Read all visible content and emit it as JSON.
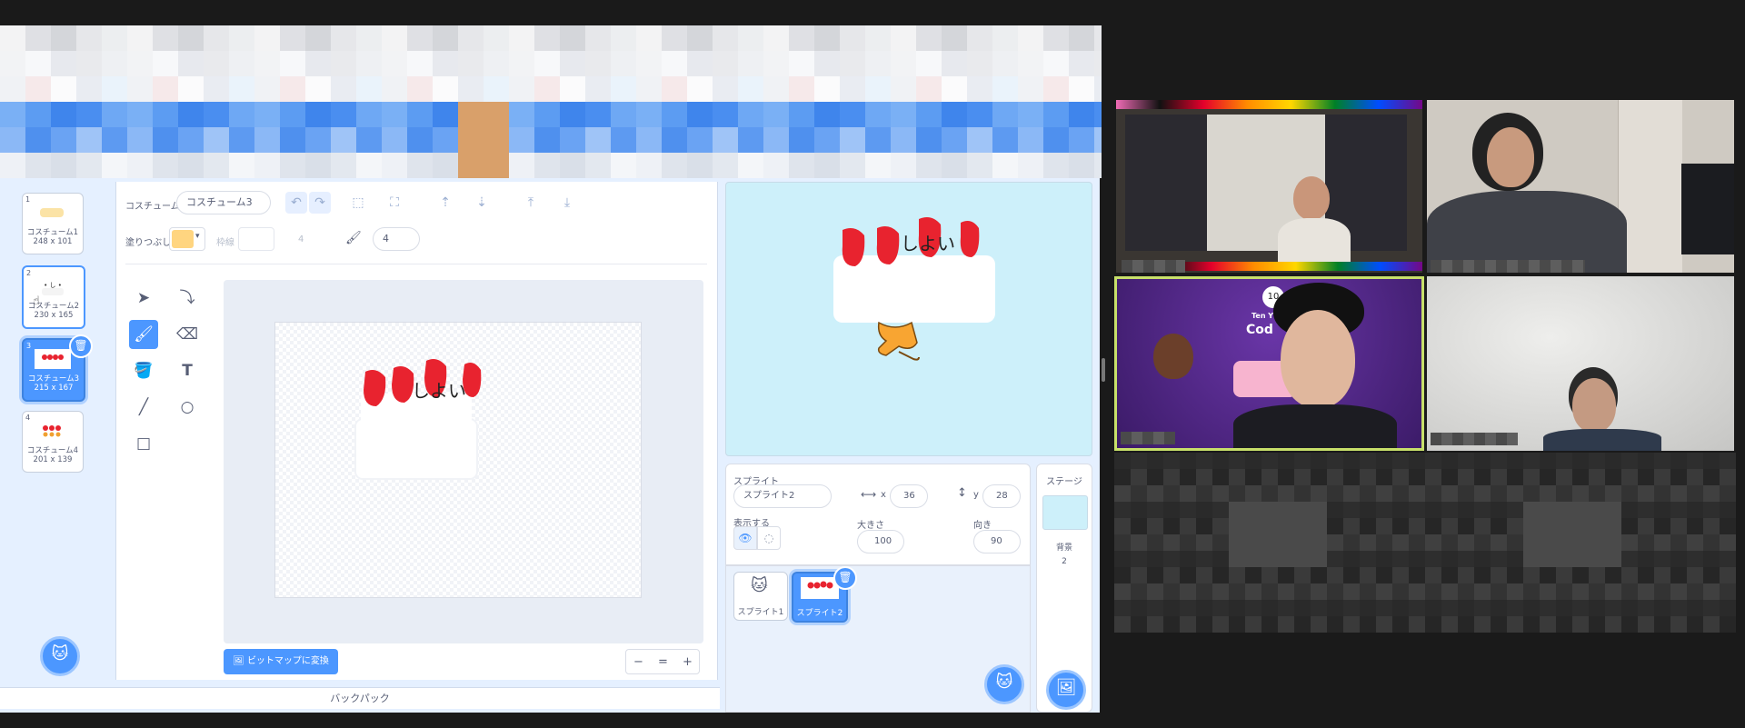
{
  "editor": {
    "costumes": [
      {
        "num": "1",
        "name": "コスチューム1",
        "size": "248 x 101"
      },
      {
        "num": "2",
        "name": "コスチューム2",
        "size": "230 x 165"
      },
      {
        "num": "3",
        "name": "コスチューム3",
        "size": "215 x 167"
      },
      {
        "num": "4",
        "name": "コスチューム4",
        "size": "201 x 139"
      }
    ],
    "selected_costume": 3,
    "paint": {
      "costume_label": "コスチューム",
      "costume_name": "コスチューム3",
      "fill_label": "塗りつぶし",
      "fill_color": "#ffd580",
      "outline_label": "枠線",
      "outline_value": "4",
      "brush_size": "4",
      "convert_button": "ビットマップに変換",
      "zoom_out": "−",
      "zoom_reset": "=",
      "zoom_in": "+"
    },
    "sprite_info": {
      "sprite_label": "スプライト",
      "sprite_name": "スプライト2",
      "x_label": "x",
      "x_value": "36",
      "y_label": "y",
      "y_value": "28",
      "show_label": "表示する",
      "size_label": "大きさ",
      "size_value": "100",
      "direction_label": "向き",
      "direction_value": "90"
    },
    "sprites": [
      {
        "name": "スプライト1"
      },
      {
        "name": "スプライト2"
      }
    ],
    "stage_panel": {
      "title": "ステージ",
      "backdrop_label": "背景",
      "backdrop_count": "2"
    },
    "backpack_label": "バックパック",
    "cake_text": "しよい"
  },
  "video_call": {
    "participant_count": 4,
    "overlay_text": [
      "10",
      "Ten Y",
      "Cod"
    ]
  },
  "colors": {
    "scratch_blue": "#4c97ff",
    "editor_bg": "#e5f0ff",
    "stage_bg": "#cdf0fa",
    "strawberry": "#e8232f",
    "active_speaker": "#c8e06a"
  }
}
